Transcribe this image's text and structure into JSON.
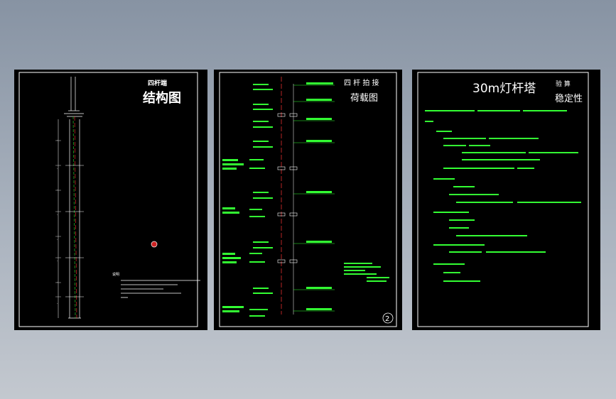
{
  "colors": {
    "background_top": "#8793a3",
    "background_bottom": "#c3c8cf",
    "sheet": "#000000",
    "frame": "#ffffff",
    "text_white": "#ffffff",
    "annotation_green": "#33ff33",
    "center_red": "#ff3333",
    "rebar_green": "#22aa22"
  },
  "sheets": [
    {
      "title_small": "四杆端",
      "title_large": "结构图",
      "notes_heading": "说明"
    },
    {
      "title_small": "四 杆 拍 接",
      "title_large": "荷载图",
      "sheet_number": "2"
    },
    {
      "title_main": "30m灯杆塔",
      "title_verify": "验 算",
      "title_stability": "稳定性"
    }
  ]
}
